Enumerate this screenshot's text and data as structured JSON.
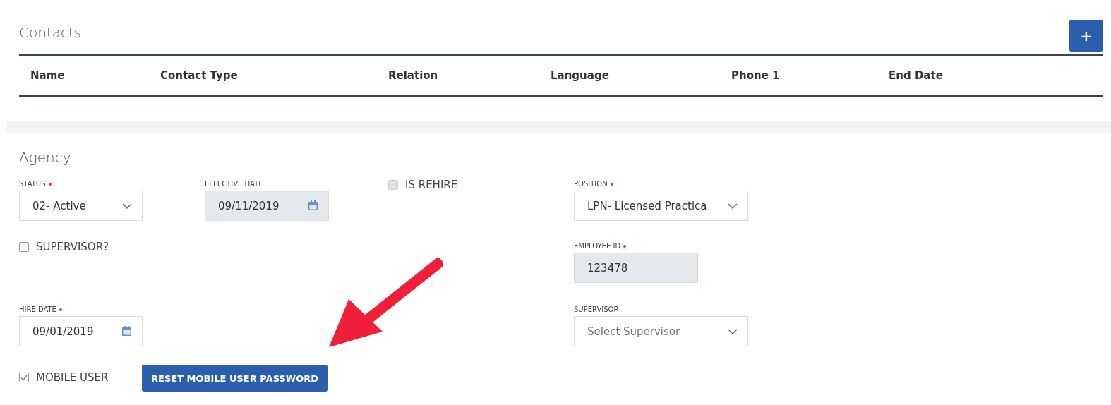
{
  "contacts": {
    "title": "Contacts",
    "add_button": "+",
    "columns": [
      "Name",
      "Contact Type",
      "Relation",
      "Language",
      "Phone 1",
      "End Date"
    ]
  },
  "agency": {
    "title": "Agency",
    "fields": [
      {
        "kind": "select",
        "label": "STATUS",
        "required": true,
        "value": "02- Active"
      },
      {
        "kind": "date",
        "label": "EFFECTIVE DATE",
        "required": false,
        "value": "09/11/2019",
        "disabled": true
      },
      {
        "kind": "checkbox",
        "label": "IS REHIRE",
        "checked": false,
        "disabled": true
      },
      {
        "kind": "select",
        "label": "POSITION",
        "required": true,
        "value": "LPN- Licensed Practica"
      },
      {
        "kind": "checkbox",
        "label": "SUPERVISOR?",
        "checked": false,
        "disabled": false
      },
      {
        "kind": "text",
        "label": "EMPLOYEE ID",
        "required": true,
        "value": "123478",
        "disabled": true
      },
      {
        "kind": "date",
        "label": "HIRE DATE",
        "required": true,
        "value": "09/01/2019",
        "disabled": false
      },
      {
        "kind": "select",
        "label": "SUPERVISOR",
        "required": false,
        "placeholder": "Select Supervisor"
      },
      {
        "kind": "checkbox",
        "label": "MOBILE USER",
        "checked": true,
        "disabled": false
      },
      {
        "kind": "button",
        "label": "RESET MOBILE USER PASSWORD"
      }
    ]
  }
}
